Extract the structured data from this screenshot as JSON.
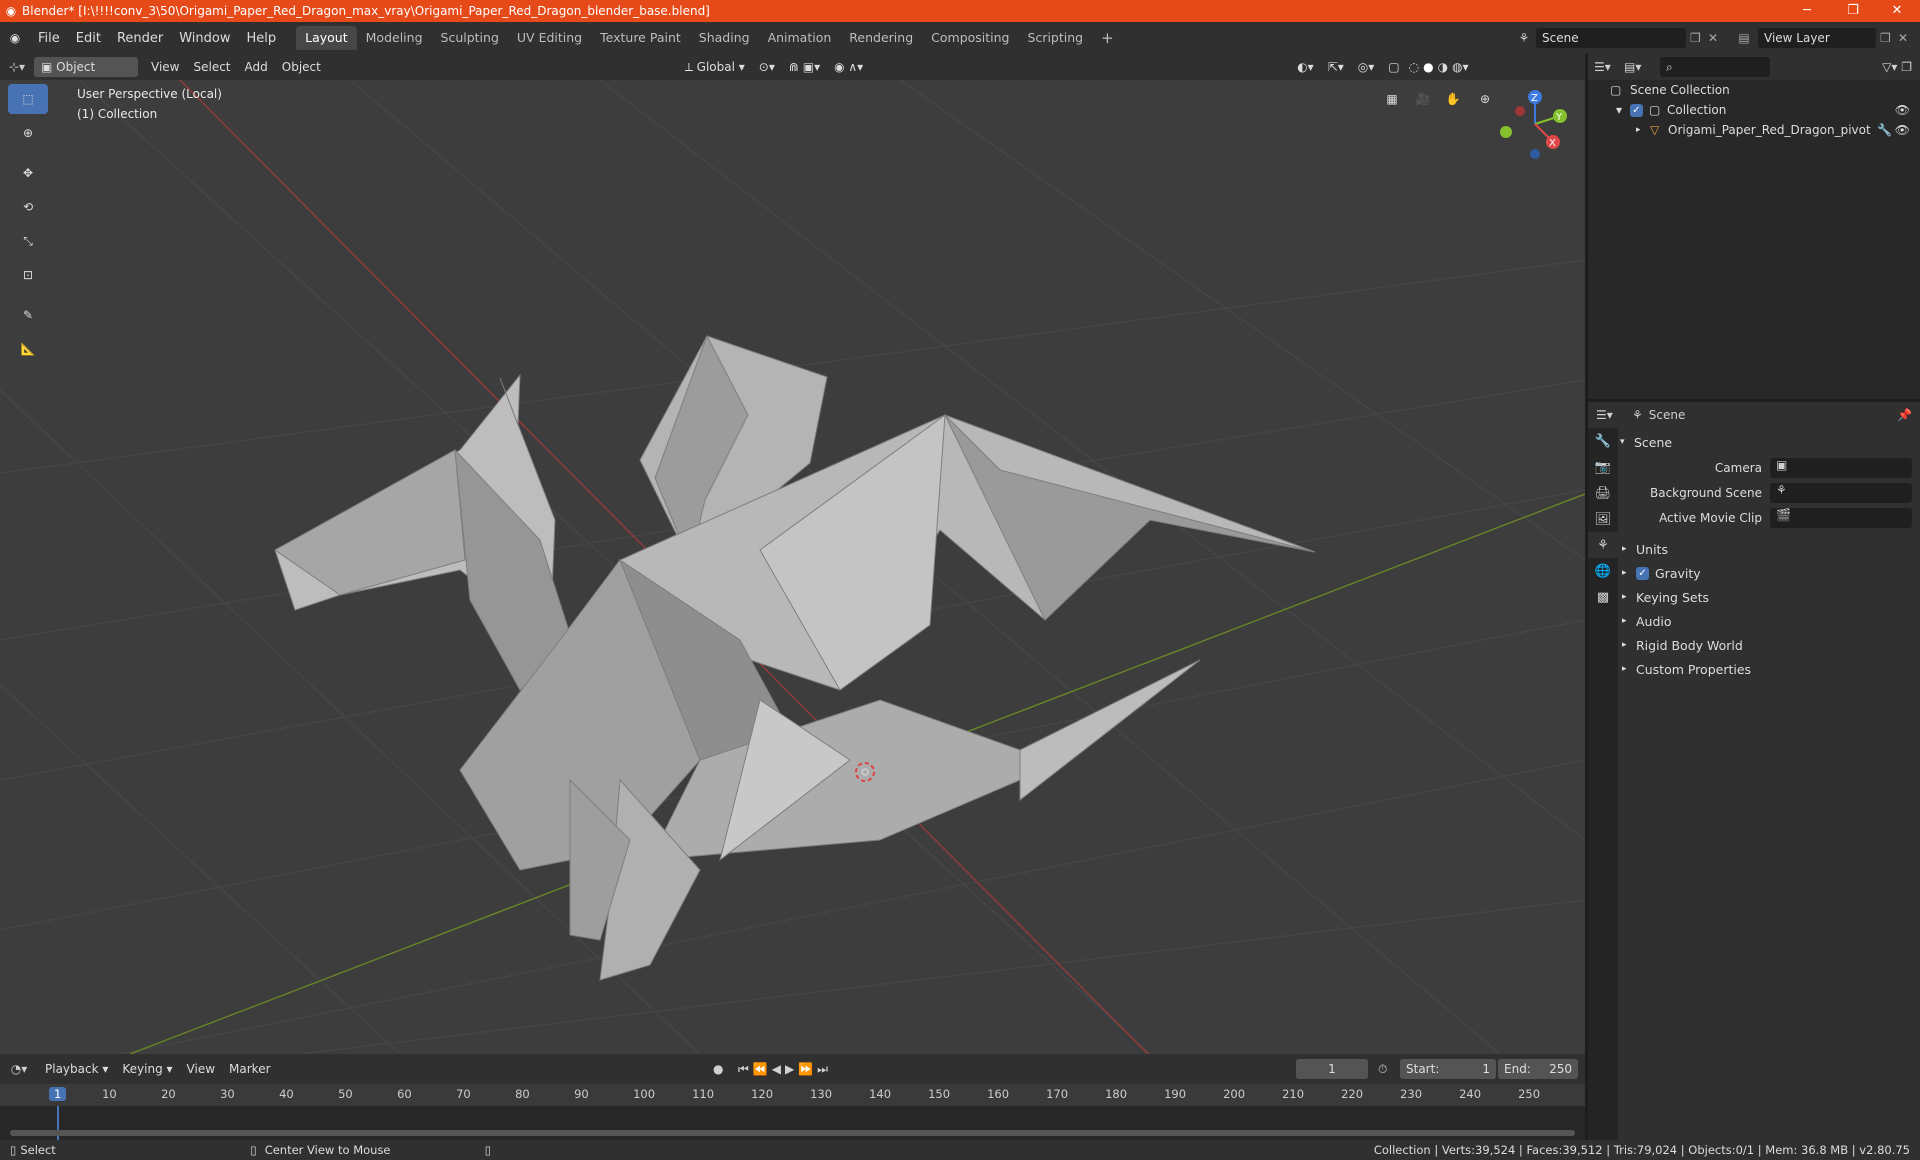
{
  "window": {
    "title": "Blender* [I:\\!!!!conv_3\\50\\Origami_Paper_Red_Dragon_max_vray\\Origami_Paper_Red_Dragon_blender_base.blend]"
  },
  "menu": [
    "File",
    "Edit",
    "Render",
    "Window",
    "Help"
  ],
  "workspaces": [
    "Layout",
    "Modeling",
    "Sculpting",
    "UV Editing",
    "Texture Paint",
    "Shading",
    "Animation",
    "Rendering",
    "Compositing",
    "Scripting"
  ],
  "active_workspace": "Layout",
  "header_right": {
    "scene": "Scene",
    "view_layer": "View Layer"
  },
  "viewport_header": {
    "mode": "Object Mode",
    "menus": [
      "View",
      "Select",
      "Add",
      "Object"
    ],
    "transform_orientation": "Global"
  },
  "viewport": {
    "perspective_label": "User Perspective (Local)",
    "collection_label": "(1) Collection",
    "gizmo_axes": {
      "z": "Z",
      "y": "Y",
      "x": "X"
    }
  },
  "outliner": {
    "scene_collection": "Scene Collection",
    "collection": "Collection",
    "object": "Origami_Paper_Red_Dragon_pivot"
  },
  "properties": {
    "context": "Scene",
    "panel_title": "Scene",
    "camera_label": "Camera",
    "background_scene_label": "Background Scene",
    "active_movie_clip_label": "Active Movie Clip",
    "sections": [
      "Units",
      "Gravity",
      "Keying Sets",
      "Audio",
      "Rigid Body World",
      "Custom Properties"
    ]
  },
  "timeline": {
    "menus": [
      "Playback",
      "Keying",
      "View",
      "Marker"
    ],
    "current_frame": "1",
    "start_label": "Start:",
    "start_value": "1",
    "end_label": "End:",
    "end_value": "250",
    "ruler_marks": [
      "1",
      "10",
      "20",
      "30",
      "40",
      "50",
      "60",
      "70",
      "80",
      "90",
      "100",
      "110",
      "120",
      "130",
      "140",
      "150",
      "160",
      "170",
      "180",
      "190",
      "200",
      "210",
      "220",
      "230",
      "240",
      "250"
    ]
  },
  "statusbar": {
    "left_action": "Select",
    "middle_action": "Center View to Mouse",
    "stats": "Collection | Verts:39,524 | Faces:39,512 | Tris:79,024 | Objects:0/1 | Mem: 36.8 MB | v2.80.75"
  }
}
